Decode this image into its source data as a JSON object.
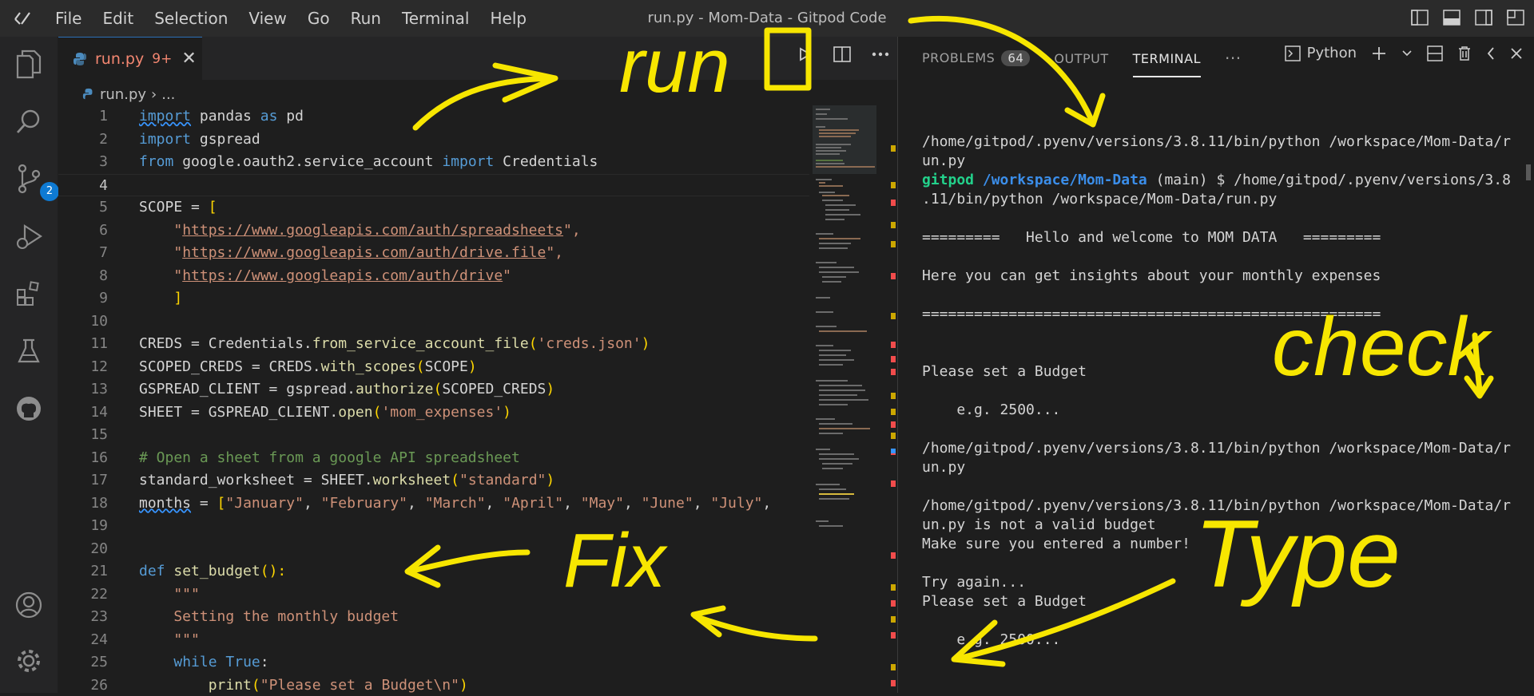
{
  "titlebar": {
    "title": "run.py - Mom-Data - Gitpod Code",
    "menu": [
      "File",
      "Edit",
      "Selection",
      "View",
      "Go",
      "Run",
      "Terminal",
      "Help"
    ]
  },
  "activity": {
    "scm_badge": "2"
  },
  "editor": {
    "tab": {
      "filename": "run.py",
      "problems": "9+"
    },
    "breadcrumb": {
      "file": "run.py",
      "rest": "..."
    },
    "line_numbers": [
      "1",
      "2",
      "3",
      "4",
      "5",
      "6",
      "7",
      "8",
      "9",
      "10",
      "11",
      "12",
      "13",
      "14",
      "15",
      "16",
      "17",
      "18",
      "19",
      "20",
      "21",
      "22",
      "23",
      "24",
      "25",
      "26"
    ],
    "code": {
      "l1": [
        "import",
        " pandas ",
        "as",
        " pd"
      ],
      "l2": [
        "import",
        " gspread"
      ],
      "l3": [
        "from",
        " google.oauth2.service_account ",
        "import",
        " Credentials"
      ],
      "l5": [
        "SCOPE = ",
        "["
      ],
      "l6": [
        "    \"",
        "https://www.googleapis.com/auth/spreadsheets",
        "\","
      ],
      "l7": [
        "    \"",
        "https://www.googleapis.com/auth/drive.file",
        "\","
      ],
      "l8": [
        "    \"",
        "https://www.googleapis.com/auth/drive",
        "\""
      ],
      "l9": [
        "    ",
        "]"
      ],
      "l11": [
        "CREDS = Credentials.",
        "from_service_account_file",
        "(",
        "'creds.json'",
        ")"
      ],
      "l12": [
        "SCOPED_CREDS = CREDS.",
        "with_scopes",
        "(",
        "SCOPE",
        ")"
      ],
      "l13": [
        "GSPREAD_CLIENT = gspread.",
        "authorize",
        "(",
        "SCOPED_CREDS",
        ")"
      ],
      "l14": [
        "SHEET = GSPREAD_CLIENT.",
        "open",
        "(",
        "'mom_expenses'",
        ")"
      ],
      "l16": "# Open a sheet from a google API spreadsheet",
      "l17": [
        "standard_worksheet = SHEET.",
        "worksheet",
        "(",
        "\"standard\"",
        ")"
      ],
      "l18": [
        "months",
        " = ",
        "[",
        "\"January\"",
        ", ",
        "\"February\"",
        ", ",
        "\"March\"",
        ", ",
        "\"April\"",
        ", ",
        "\"May\"",
        ", ",
        "\"June\"",
        ", ",
        "\"July\"",
        ","
      ],
      "l21": [
        "def",
        " ",
        "set_budget",
        "():"
      ],
      "l22": "    \"\"\"",
      "l23": "    Setting the monthly budget",
      "l24": "    \"\"\"",
      "l25": [
        "    ",
        "while",
        " ",
        "True",
        ":"
      ],
      "l26": [
        "        ",
        "print",
        "(",
        "\"Please set a Budget\\n\"",
        ")"
      ]
    }
  },
  "panel": {
    "tabs": {
      "problems": "PROBLEMS",
      "problems_count": "64",
      "output": "OUTPUT",
      "terminal": "TERMINAL"
    },
    "profile": "Python",
    "terminal": {
      "l1": "/home/gitpod/.pyenv/versions/3.8.11/bin/python /workspace/Mom-Data/r",
      "l2": "un.py",
      "p_user": "gitpod",
      "p_path": " /workspace/Mom-Data",
      "p_rest": " (main) $ /home/gitpod/.pyenv/versions/3.8",
      "l4": ".11/bin/python /workspace/Mom-Data/run.py",
      "l5": "=========   Hello and welcome to MOM DATA   =========",
      "l6": "Here you can get insights about your monthly expenses",
      "l7": "=====================================================",
      "l8": "Please set a Budget",
      "l9": "    e.g. 2500...",
      "l10": "/home/gitpod/.pyenv/versions/3.8.11/bin/python /workspace/Mom-Data/r",
      "l11": "un.py",
      "l12": "/home/gitpod/.pyenv/versions/3.8.11/bin/python /workspace/Mom-Data/r",
      "l13": "un.py is not a valid budget",
      "l14": "Make sure you entered a number!",
      "l15": "Try again...",
      "l16": "Please set a Budget",
      "l17": "    e.g. 2500..."
    }
  },
  "annotations": {
    "run": "run",
    "check": "check",
    "fix": "Fix",
    "type": "Type",
    "color": "#f7e600"
  }
}
